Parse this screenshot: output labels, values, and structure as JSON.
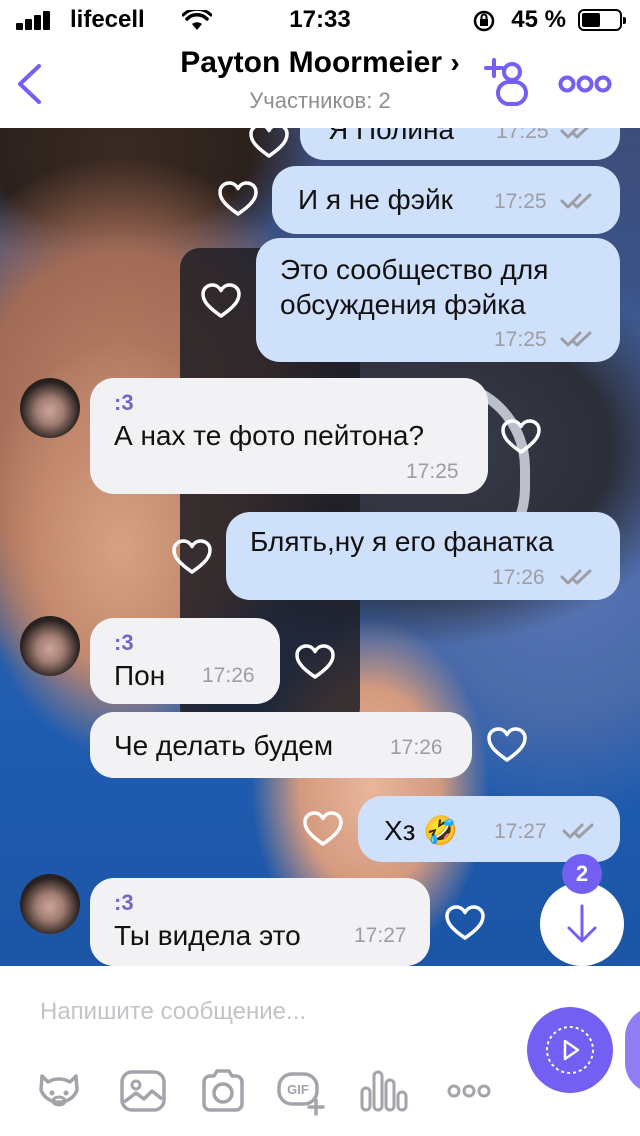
{
  "status": {
    "carrier": "lifecell",
    "time": "17:33",
    "battery_pct": "45 %"
  },
  "header": {
    "back_icon": "chevron-left-icon",
    "title": "Payton Moormeier",
    "title_chevron": "›",
    "subtitle": "Участников: 2",
    "add_icon": "add-participant-icon",
    "more_icon": "more-icon",
    "accent_color": "#7360f2"
  },
  "messages": [
    {
      "text": "Я Полина",
      "time": "17:25",
      "direction": "out"
    },
    {
      "text": "И я не фэйк",
      "time": "17:25",
      "direction": "out"
    },
    {
      "line1": "Это сообщество для",
      "line2": "обсуждения фэйка",
      "time": "17:25",
      "direction": "out"
    },
    {
      "sender": ":3",
      "text": "А нах те фото пейтона?",
      "time": "17:25",
      "direction": "in"
    },
    {
      "text": "Блять,ну я его фанатка",
      "time": "17:26",
      "direction": "out"
    },
    {
      "sender": ":3",
      "text": "Пон",
      "time": "17:26",
      "direction": "in"
    },
    {
      "text": "Че делать будем",
      "time": "17:26",
      "direction": "in"
    },
    {
      "text": "Хз",
      "emoji": "🤣",
      "time": "17:27",
      "direction": "out"
    },
    {
      "sender": ":3",
      "text": "Ты видела это",
      "time": "17:27",
      "direction": "in"
    }
  ],
  "scroll_down": {
    "badge": "2",
    "icon": "arrow-down-icon"
  },
  "composer": {
    "placeholder": "Напишите сообщение...",
    "tools": [
      "sticker-icon",
      "gallery-icon",
      "camera-icon",
      "gif-icon",
      "voice-icon",
      "more-icon"
    ],
    "send_icon": "play-icon"
  }
}
